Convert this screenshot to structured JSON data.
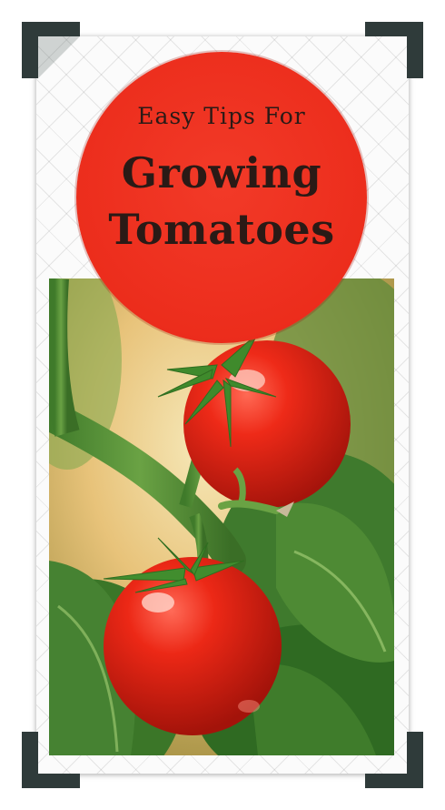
{
  "badge": {
    "line1": "Easy Tips For",
    "line2": "Growing",
    "line3": "Tomatoes"
  },
  "colors": {
    "badge_red": "#ec2d1c",
    "text_dark": "#2a1a16",
    "corner_dark": "#2f3b3a",
    "tomato_red": "#e01f14",
    "leaf_green": "#3d7d2a"
  },
  "photo": {
    "subject": "two red cherry tomatoes on vine"
  }
}
